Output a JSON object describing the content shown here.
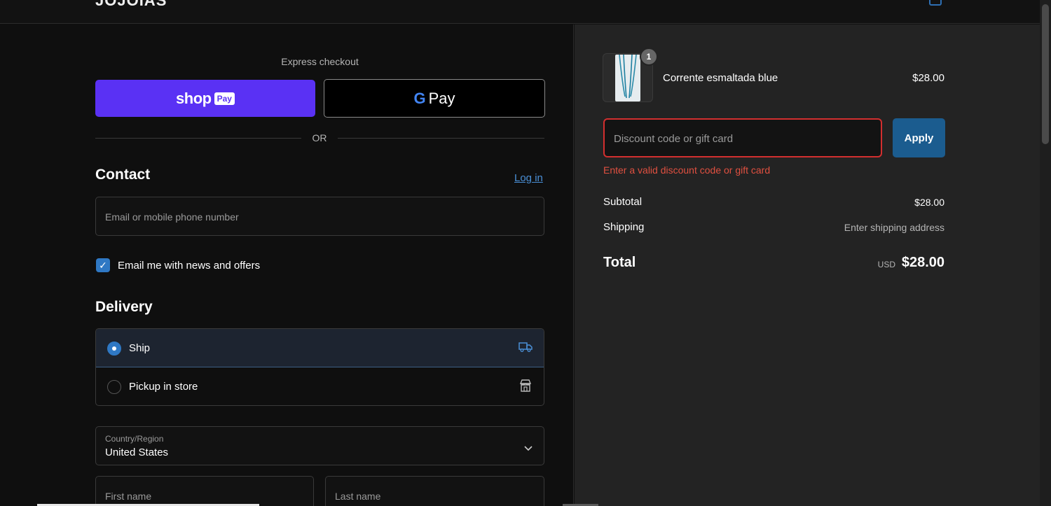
{
  "store": {
    "logo": "JOJOIAS"
  },
  "express": {
    "title": "Express checkout",
    "shoppay_text": "shop",
    "shoppay_badge": "Pay",
    "gpay_g": "G",
    "gpay_text": "Pay",
    "or": "OR"
  },
  "contact": {
    "heading": "Contact",
    "login": "Log in",
    "email_placeholder": "Email or mobile phone number",
    "newsletter_label": "Email me with news and offers",
    "newsletter_checked": true
  },
  "delivery": {
    "heading": "Delivery",
    "options": [
      {
        "label": "Ship",
        "selected": true,
        "icon": "truck-icon"
      },
      {
        "label": "Pickup in store",
        "selected": false,
        "icon": "store-icon"
      }
    ],
    "country_label": "Country/Region",
    "country_value": "United States",
    "first_name_placeholder": "First name",
    "last_name_placeholder": "Last name"
  },
  "summary": {
    "product": {
      "name": "Corrente esmaltada blue",
      "price": "$28.00",
      "quantity": "1"
    },
    "discount_placeholder": "Discount code or gift card",
    "apply_label": "Apply",
    "discount_error": "Enter a valid discount code or gift card",
    "subtotal_label": "Subtotal",
    "subtotal_value": "$28.00",
    "shipping_label": "Shipping",
    "shipping_value": "Enter shipping address",
    "total_label": "Total",
    "total_currency": "USD",
    "total_value": "$28.00"
  },
  "colors": {
    "accent": "#2f78c4",
    "shoppay": "#5a31f4",
    "error": "#d32f2f",
    "apply": "#1b5c8f"
  }
}
